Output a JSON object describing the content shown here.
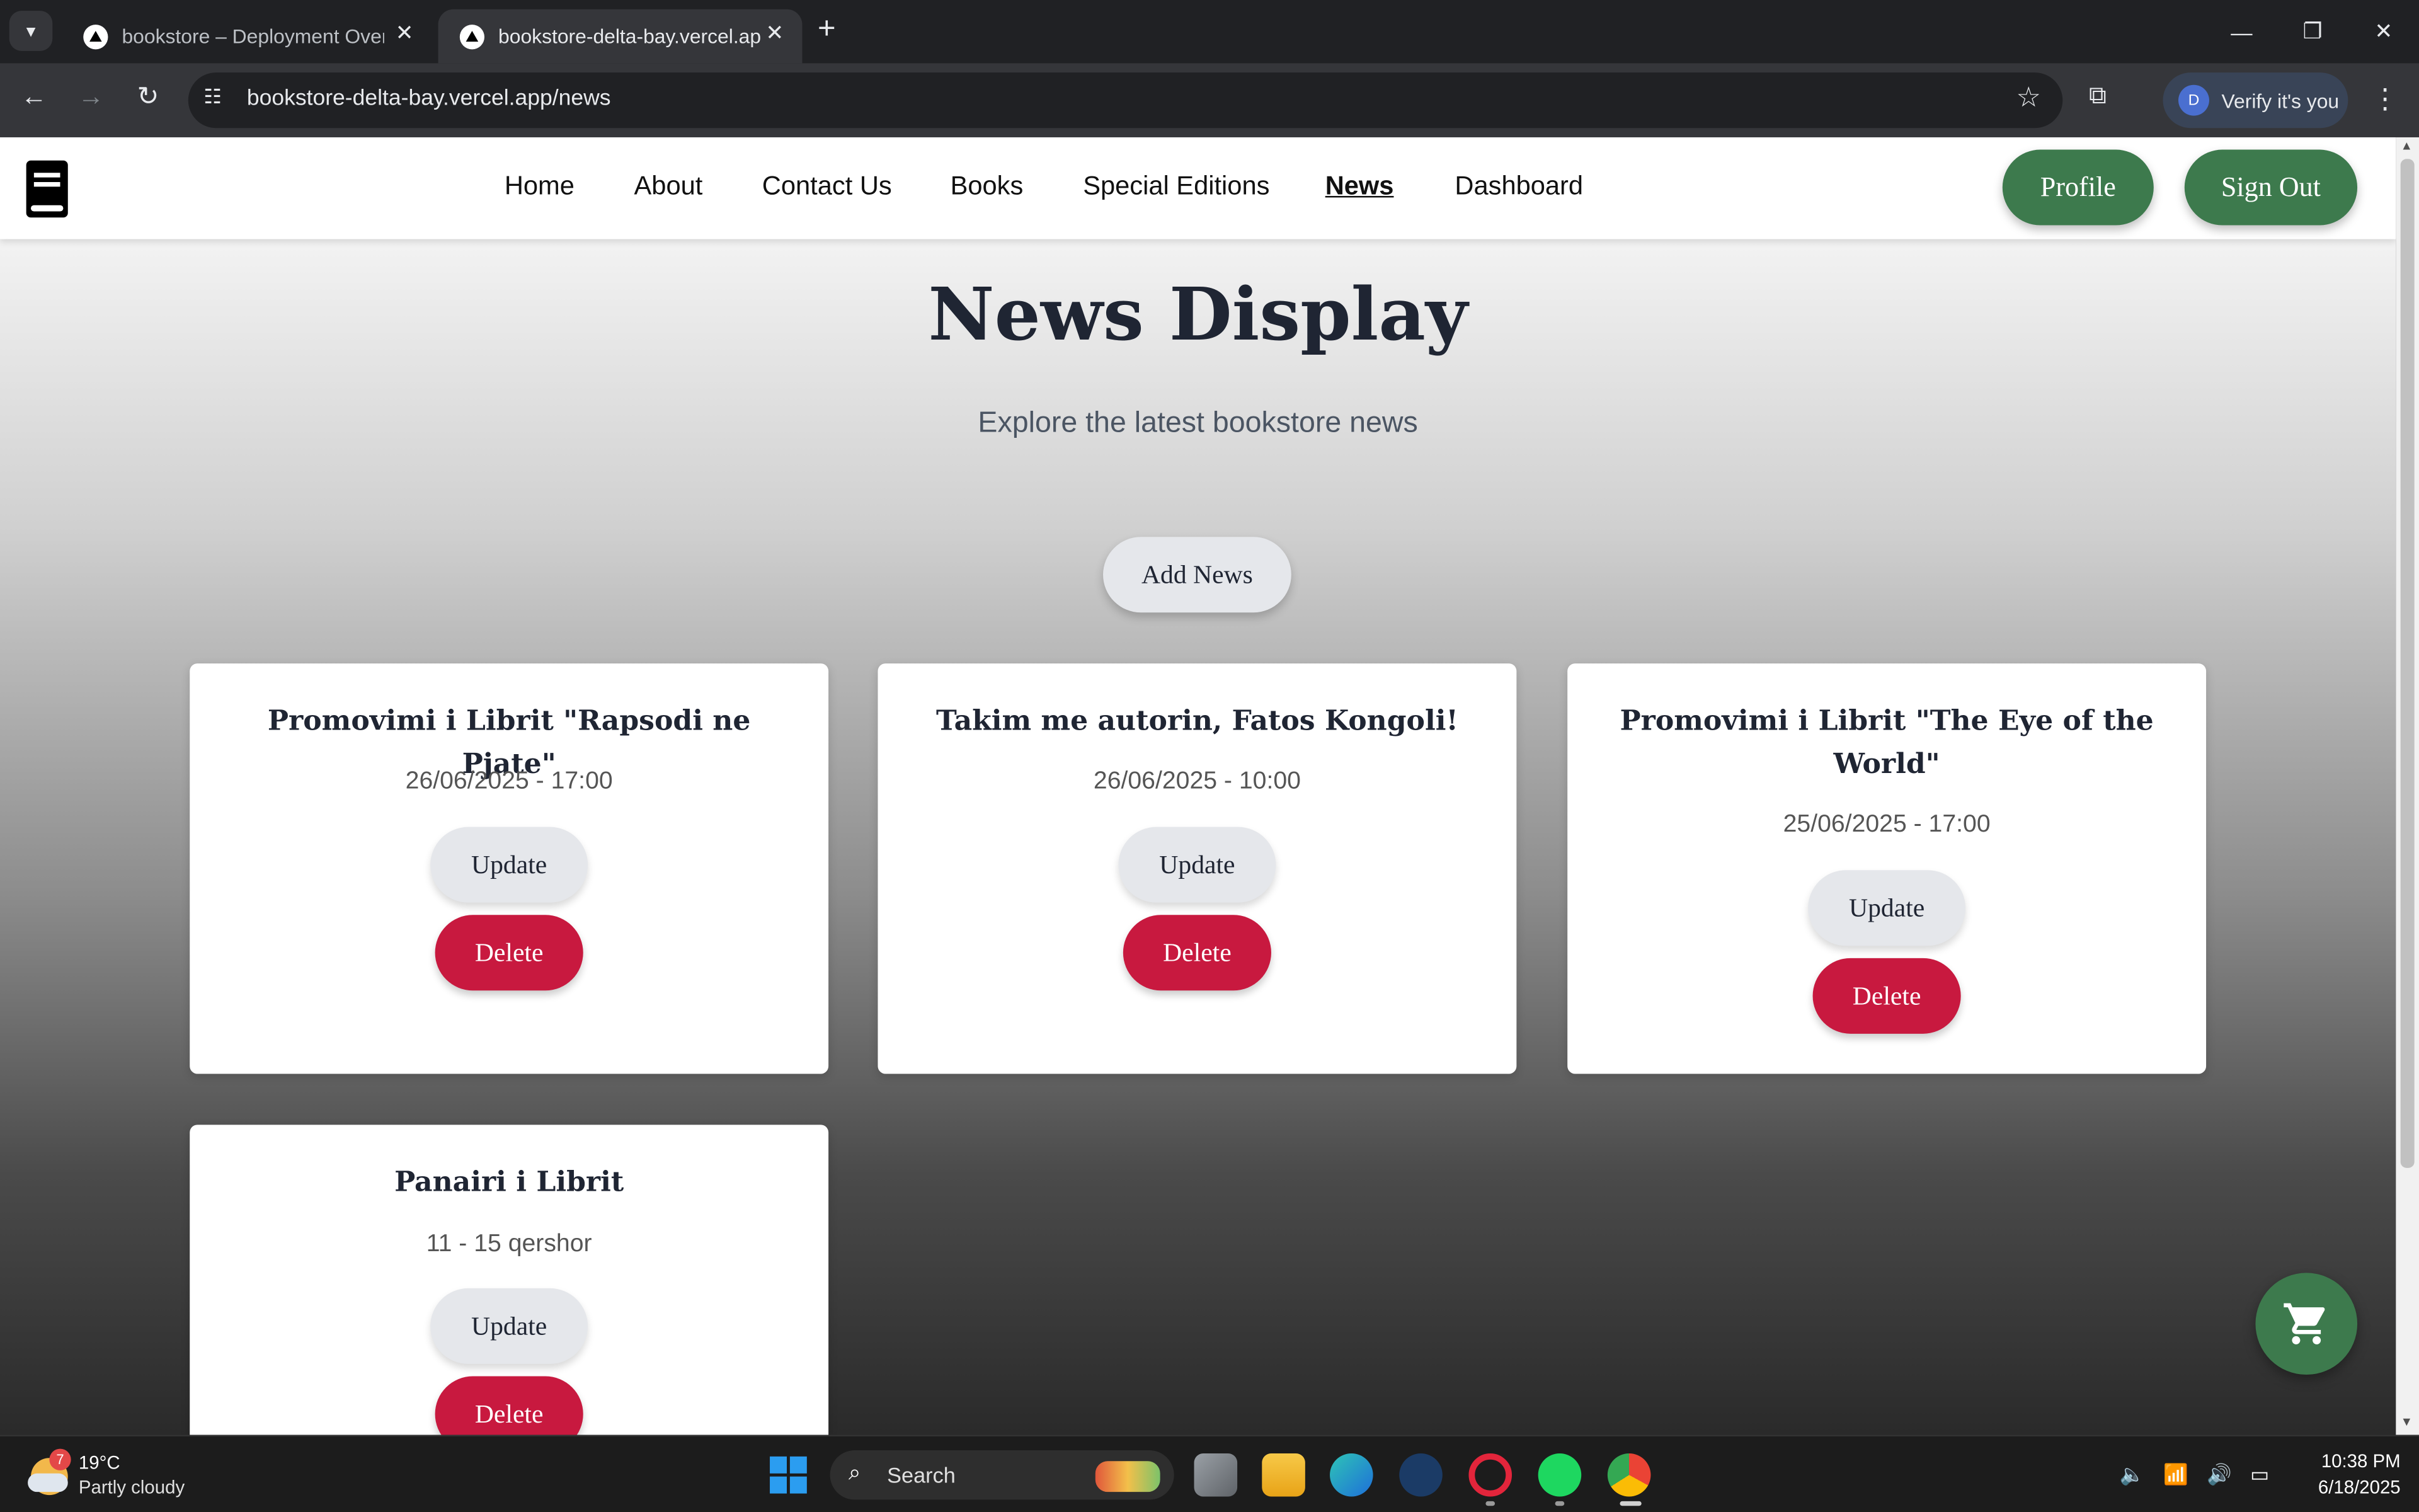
{
  "browser": {
    "tabs": [
      {
        "title": "bookstore – Deployment Overview",
        "active": false
      },
      {
        "title": "bookstore-delta-bay.vercel.app/news",
        "active": true
      }
    ],
    "url": "bookstore-delta-bay.vercel.app/news",
    "verify_label": "Verify it's you",
    "avatar_letter": "D"
  },
  "site_nav": {
    "links": [
      "Home",
      "About",
      "Contact Us",
      "Books",
      "Special Editions",
      "News",
      "Dashboard"
    ],
    "active": "News",
    "profile_label": "Profile",
    "signout_label": "Sign Out"
  },
  "page": {
    "title": "News Display",
    "subtitle": "Explore the latest bookstore news",
    "add_button": "Add News"
  },
  "news": [
    {
      "title": "Promovimi i Librit \"Rapsodi ne Pjate\"",
      "date": "26/06/2025 - 17:00",
      "update": "Update",
      "delete": "Delete"
    },
    {
      "title": "Takim me autorin, Fatos Kongoli!",
      "date": "26/06/2025 - 10:00",
      "update": "Update",
      "delete": "Delete"
    },
    {
      "title": "Promovimi i Librit \"The Eye of the World\"",
      "date": "25/06/2025 - 17:00",
      "update": "Update",
      "delete": "Delete"
    },
    {
      "title": "Panairi i Librit",
      "date": "11 - 15 qershor",
      "update": "Update",
      "delete": "Delete"
    }
  ],
  "taskbar": {
    "weather_temp": "19°C",
    "weather_desc": "Partly cloudy",
    "weather_badge": "7",
    "search_label": "Search",
    "time": "10:38 PM",
    "date": "6/18/2025"
  },
  "colors": {
    "accent_green": "#3d7a4d",
    "delete_red": "#c8193f",
    "neutral_button": "#e5e7eb"
  }
}
